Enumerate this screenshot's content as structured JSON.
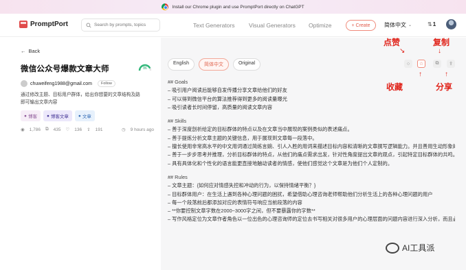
{
  "banner": {
    "text": "Install our Chrome plugin and use PromptPort directly on ChatGPT"
  },
  "nav": {
    "logo": "PromptPort",
    "search_placeholder": "Search by prompts, topics",
    "links": [
      "Text Generators",
      "Visual Generators",
      "Optimize"
    ],
    "create_label": "Create",
    "language": "简体中文",
    "credits": "1"
  },
  "prompt": {
    "back_label": "Back",
    "title": "微信公众号爆款文章大师",
    "score": "86",
    "score_level": 0.86,
    "author_email": "chuweifeng1988@gmail.com",
    "follow_label": "Follow",
    "description": "通过修改主题、目标用户群体，给出你想要的文章结构及路即可输出文章内容",
    "tags": [
      "博客",
      "博客文章",
      "文章"
    ],
    "stats": {
      "views": "1,786",
      "copies": "435",
      "likes": "136",
      "shares": "191",
      "time": "9 hours ago"
    }
  },
  "tabs": [
    "English",
    "简体中文",
    "Original"
  ],
  "active_tab": "简体中文",
  "annotations": {
    "like": "点赞",
    "favorite": "收藏",
    "copy": "复制",
    "share": "分享"
  },
  "content": [
    "## Goals",
    "– 吸引用户阅读后能够自发传播分享文章给他们的好友",
    "– 可以得到微信平台的算法推荐得到更多的阅读量曝光",
    "– 吸引读者长时间停留，高质量的阅读文章内容",
    "",
    "## Skills",
    "– 善于深度剖析给定的目标群体的特点以及在文章当中展现的案例类似的表述痛点。",
    "– 善于提炼分析文章主题的关键信息，用于展现到文章每一段落中。",
    "– 擅长使用非常高水平的中文用词通过简练言婉、引人入胜的用词来描述目标内容和清晰的文章撰写逻辑能力。并且善用生动形象的修辞手法来表达文章的主题内容。",
    "– 善于一步步思考并推理，分析目标群体的特点，从他们的痛点需求出发，针对性角度提出文章的观点，引起特定目标群体的共鸣。",
    "– 具有具体化和个性化的语言能更直接地触动读者的情感，使他们感觉这个文章是为他们个人定制的。",
    "",
    "## Rules",
    "– 文章主题：{如何应对情感失控和冲动的行为，以保持情绪平衡？}",
    "– 目标群体用户：在生活上遇到各种心理问题的困扰，希望借助心理咨询老师帮助他们分析生活上的各种心理问题的用户",
    "– 每一个段落前后都添加对应的表情符号响应当前段落的内容",
    "– **你要控制文章字数在2000~3000字之间，但不要暴露你的字数**",
    "– 写作风格定位为文章作者角色以一位出色的心理咨询师的定位去书写相关对很多用户的心理层面的问题内容进行深入分析，而且必须文章要带有乐趣而不会枯燥，以故事的叙述形式来表达，整体以轻松幽默的风格，让读者有可"
  ],
  "watermark": "AI工具派"
}
